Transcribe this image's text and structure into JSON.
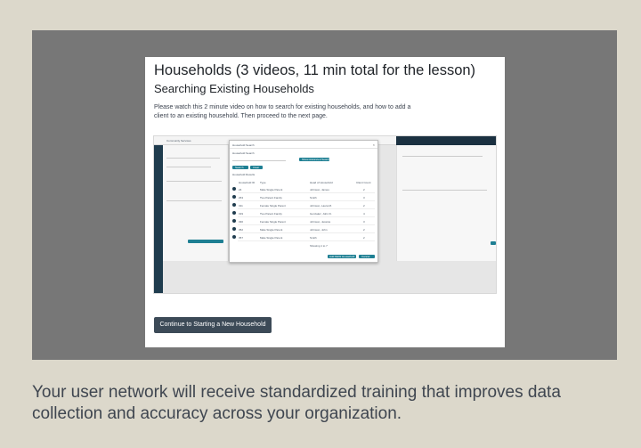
{
  "lesson": {
    "title": "Households (3 videos, 11 min total for the lesson)",
    "subtitle": "Searching Existing Households",
    "description": "Please watch this 2 minute video on how to search for existing households, and how to add a client to an existing household.  Then proceed to the next page."
  },
  "video": {
    "app_name": "Community Services",
    "modal_title": "Household Search",
    "search_section": "Household Search",
    "show_advanced": "Show Advanced Search",
    "search_button": "Search",
    "clear_button": "Clear",
    "results_section": "Household Results",
    "columns": [
      "Household ID",
      "Type",
      "Head of Household",
      "Client Count"
    ],
    "rows": [
      [
        "24",
        "Male Single Parent",
        "Johnson, James",
        "2"
      ],
      [
        "263",
        "Two Parent Family",
        "Smith",
        "3"
      ],
      [
        "311",
        "Female Single Parent",
        "Johnson, Laura M.",
        "2"
      ],
      [
        "319",
        "Two Parent Family",
        "Gonzalez, John D.",
        "4"
      ],
      [
        "330",
        "Female Single Parent",
        "Johnson, Jessica",
        "3"
      ],
      [
        "352",
        "Male Single Parent",
        "Johnson, John",
        "2"
      ],
      [
        "357",
        "Male Single Parent",
        "Smith",
        "2"
      ]
    ],
    "showing": "Showing 1 to 7",
    "add_new_button": "Add NEW Household",
    "cancel_button": "Cancel"
  },
  "continue_button": "Continue to Starting a New Household",
  "caption": "Your user network will receive standardized training that improves data collection and accuracy across your organization."
}
